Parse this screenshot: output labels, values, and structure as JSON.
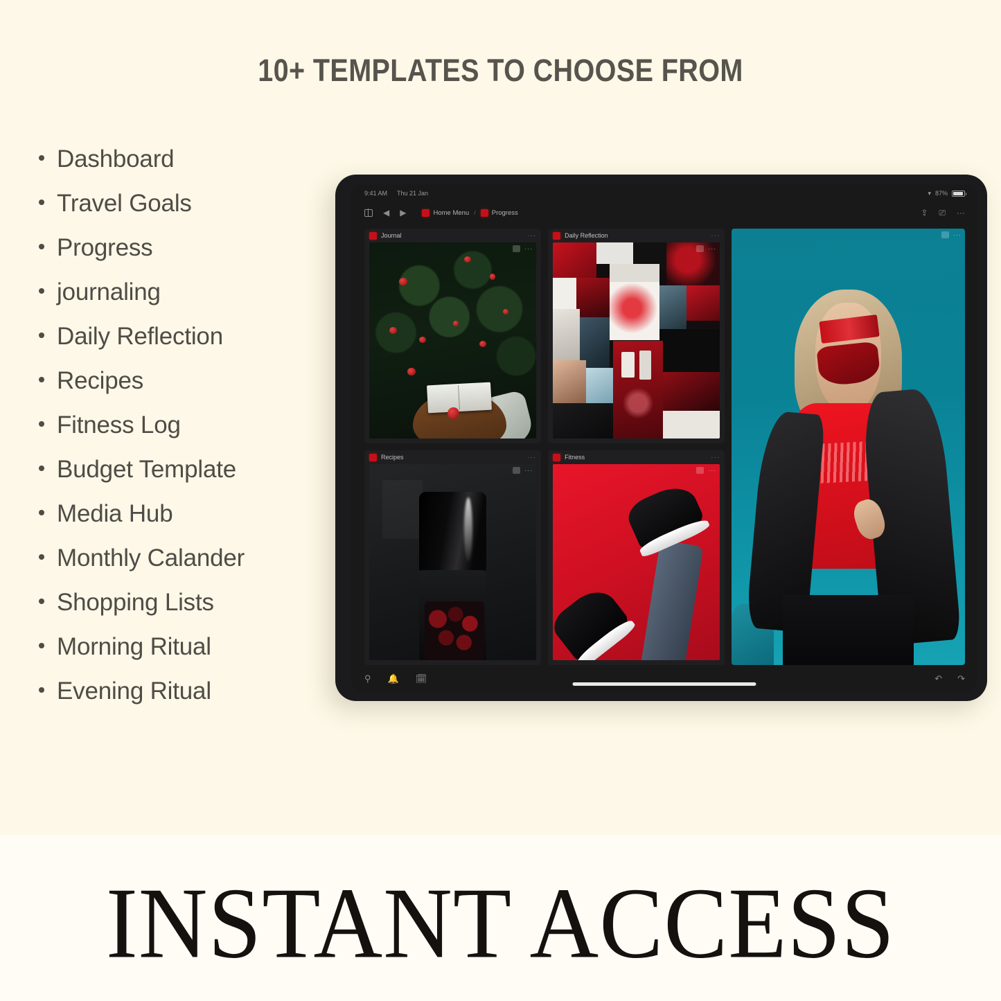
{
  "page": {
    "headline": "10+ TEMPLATES TO CHOOSE FROM",
    "footer_headline": "INSTANT ACCESS",
    "bg_top": "#FDF8E7",
    "bg_bottom": "#FEFCF5",
    "heading_color": "#57544E",
    "accent_red": "#C61018"
  },
  "templates": [
    {
      "label": "Dashboard"
    },
    {
      "label": "Travel Goals"
    },
    {
      "label": "Progress"
    },
    {
      "label": "journaling"
    },
    {
      "label": "Daily Reflection"
    },
    {
      "label": "Recipes"
    },
    {
      "label": "Fitness Log"
    },
    {
      "label": "Budget Template"
    },
    {
      "label": "Media Hub"
    },
    {
      "label": "Monthly Calander"
    },
    {
      "label": "Shopping Lists"
    },
    {
      "label": "Morning Ritual"
    },
    {
      "label": "Evening Ritual"
    }
  ],
  "tablet": {
    "status_bar": {
      "time": "9:41 AM",
      "date": "Thu 21 Jan",
      "wifi_icon": "wifi-icon",
      "battery_level": "87%",
      "battery_icon": "battery-icon"
    },
    "toolbar": {
      "sidebar_icon": "sidebar-toggle-icon",
      "back_icon": "back-arrow-icon",
      "forward_icon": "forward-arrow-icon",
      "breadcrumb": [
        {
          "label": "Home Menu",
          "icon": "page-icon"
        },
        {
          "label": "Progress",
          "icon": "page-icon"
        }
      ],
      "separator": "/",
      "share_icon": "share-icon",
      "comment_icon": "comment-icon",
      "more_icon": "more-options-icon"
    },
    "cards": [
      {
        "title": "Journal",
        "menu": "···",
        "art": "journal"
      },
      {
        "title": "Daily Reflection",
        "menu": "···",
        "art": "mood"
      },
      {
        "title": "Recipes",
        "menu": "···",
        "art": "recipe"
      },
      {
        "title": "Fitness",
        "menu": "···",
        "art": "fitness"
      },
      {
        "title": "",
        "menu": "···",
        "art": "portrait"
      }
    ],
    "bottom_bar": {
      "search_icon": "search-icon",
      "notifications_icon": "bell-icon",
      "calendar_icon": "calendar-icon",
      "undo_icon": "undo-icon",
      "redo_icon": "redo-icon"
    }
  }
}
